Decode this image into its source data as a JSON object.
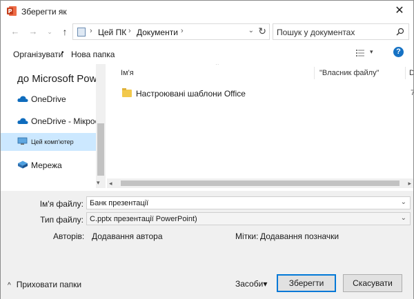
{
  "window": {
    "title": "Зберегти як",
    "close_glyph": "✕"
  },
  "nav": {
    "back": "←",
    "forward": "→",
    "recent": "⌄",
    "up": "↑",
    "crumbs": [
      "Цей ПК",
      "Документи"
    ],
    "separator": "›",
    "dropdown": "⌄",
    "refresh": "↻",
    "search_placeholder": "Пошук у документах"
  },
  "toolbar": {
    "organize": "Організувати",
    "organize_dot": "•",
    "new_folder": "Нова папка",
    "view_dropdown": "▾",
    "help": "?"
  },
  "navpane": {
    "top_label": "до Microsoft PowerPC",
    "items": [
      {
        "label": "OneDrive",
        "icon": "cloud-icon"
      },
      {
        "label": "OneDrive -  Мікрос",
        "icon": "cloud-icon"
      },
      {
        "label": "Цей комп'ютер",
        "icon": "computer-icon",
        "selected": true
      },
      {
        "label": "Мережа",
        "icon": "network-icon"
      }
    ],
    "scroll_down": "▾"
  },
  "filelist": {
    "columns": [
      "Ім'я",
      "\"Власник файлу\"",
      "D"
    ],
    "sort_caret": "⌃",
    "rows": [
      {
        "name": "Настроювані шаблони Office",
        "icon": "folder-icon",
        "trailing": "7"
      }
    ],
    "scroll_left": "◂",
    "scroll_right": "▸"
  },
  "form": {
    "filename_label": "Ім'я файлу:",
    "filename_value": "Банк презентації",
    "filetype_label": "Тип файлу:",
    "filetype_value": "С.pptx презентації PowerPoint)",
    "authors_label": "Авторів:",
    "authors_value": "Додавання автора",
    "tags_label": "Мітки:",
    "tags_value": "Додавання позначки",
    "dropdown": "⌄"
  },
  "footer": {
    "hide_folders": "Приховати папки",
    "hide_chevron": "^",
    "tools": "Засоби",
    "tools_caret": "▾",
    "save": "Зберегти",
    "cancel": "Скасувати"
  },
  "colors": {
    "accent": "#0078d7",
    "selected_bg": "#cce8ff",
    "ppt_red": "#c43e1c",
    "help_blue": "#1672c4"
  }
}
